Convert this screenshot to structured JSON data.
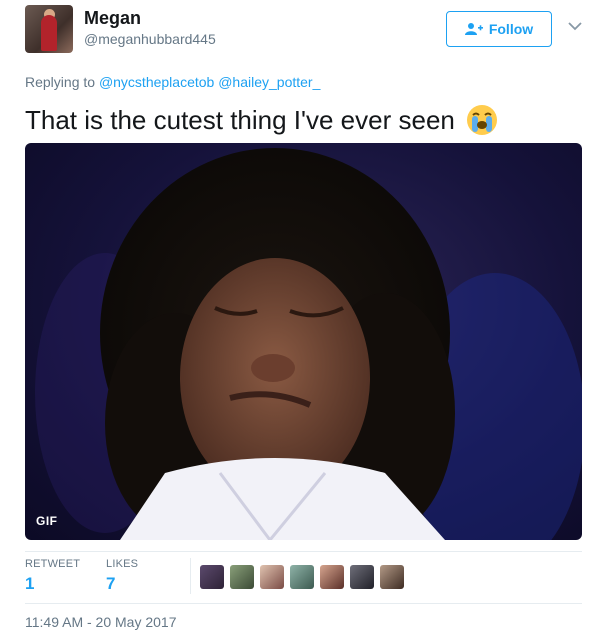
{
  "user": {
    "name": "Megan",
    "handle": "@meganhubbard445"
  },
  "follow": {
    "label": "Follow"
  },
  "reply": {
    "prefix": "Replying to",
    "mentions": [
      "@nycstheplacetob",
      "@hailey_potter_"
    ]
  },
  "tweet": {
    "text": "That is the cutest thing I've ever seen",
    "emoji": "loudly-crying-face"
  },
  "media": {
    "badge": "GIF"
  },
  "stats": {
    "retweets_label": "RETWEET",
    "retweets_value": "1",
    "likes_label": "LIKES",
    "likes_value": "7"
  },
  "timestamp": "11:49 AM - 20 May 2017",
  "colors": {
    "accent": "#1da1f2",
    "muted": "#657786",
    "text": "#14171a"
  }
}
